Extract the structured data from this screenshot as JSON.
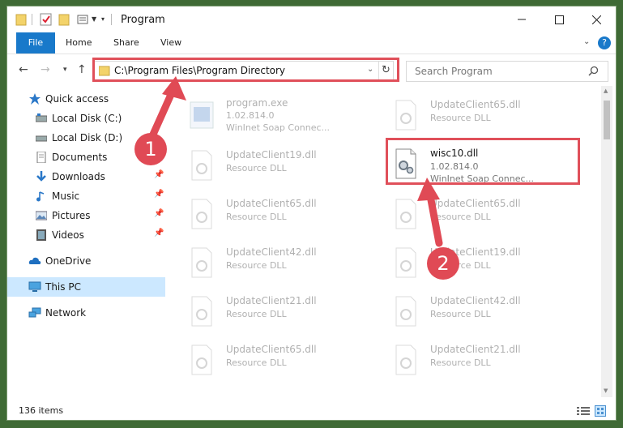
{
  "window": {
    "title": "Program"
  },
  "ribbon": {
    "tabs": [
      "File",
      "Home",
      "Share",
      "View"
    ],
    "help": "?"
  },
  "address": {
    "path": "C:\\Program Files\\Program Directory"
  },
  "search": {
    "placeholder": "Search Program"
  },
  "sidebar": {
    "items": [
      {
        "label": "Quick access",
        "icon": "star-icon"
      },
      {
        "label": "Local Disk (C:)",
        "icon": "drive-icon"
      },
      {
        "label": "Local Disk (D:)",
        "icon": "drive-icon"
      },
      {
        "label": "Documents",
        "icon": "documents-icon"
      },
      {
        "label": "Downloads",
        "icon": "download-icon"
      },
      {
        "label": "Music",
        "icon": "music-icon"
      },
      {
        "label": "Pictures",
        "icon": "pictures-icon"
      },
      {
        "label": "Videos",
        "icon": "video-icon"
      },
      {
        "label": "OneDrive",
        "icon": "cloud-icon"
      },
      {
        "label": "This PC",
        "icon": "computer-icon"
      },
      {
        "label": "Network",
        "icon": "network-icon"
      }
    ]
  },
  "files": {
    "left": [
      {
        "name": "program.exe",
        "line2": "1.02.814.0",
        "line3": "WinInet Soap Connec..."
      },
      {
        "name": "UpdateClient19.dll",
        "line2": "Resource DLL"
      },
      {
        "name": "UpdateClient65.dll",
        "line2": "Resource DLL"
      },
      {
        "name": "UpdateClient42.dll",
        "line2": "Resource DLL"
      },
      {
        "name": "UpdateClient21.dll",
        "line2": "Resource DLL"
      },
      {
        "name": "UpdateClient65.dll",
        "line2": "Resource DLL"
      }
    ],
    "right": [
      {
        "name": "UpdateClient65.dll",
        "line2": "Resource DLL"
      },
      {
        "name": "wisc10.dll",
        "line2": "1.02.814.0",
        "line3": "WinInet Soap Connec..."
      },
      {
        "name": "UpdateClient65.dll",
        "line2": "Resource DLL"
      },
      {
        "name": "UpdateClient19.dll",
        "line2": "Resource DLL"
      },
      {
        "name": "UpdateClient42.dll",
        "line2": "Resource DLL"
      },
      {
        "name": "UpdateClient21.dll",
        "line2": "Resource DLL"
      }
    ]
  },
  "status": {
    "count": "136 items"
  },
  "annotations": {
    "step1": "1",
    "step2": "2"
  },
  "colors": {
    "accent": "#1979ca",
    "highlight": "#e0505a",
    "selected": "#cce8ff"
  }
}
